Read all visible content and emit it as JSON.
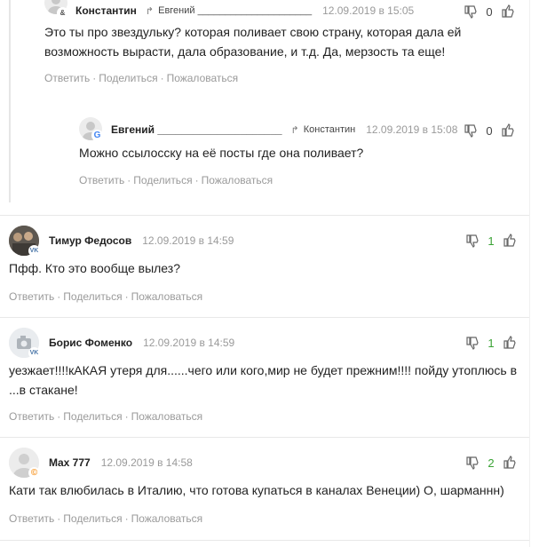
{
  "actions": {
    "reply": "Ответить",
    "share": "Поделиться",
    "report": "Пожаловаться",
    "separator": "·"
  },
  "comments": [
    {
      "author": "Константин",
      "reply_to": "Евгений _____________________",
      "date": "12.09.2019 в 15:05",
      "text": "Это ты про звездульку? которая поливает свою страну, которая дала ей возможность вырасти, дала образование, и т.д. Да, мерзость та еще!",
      "votes": "0",
      "avatar_badge": "&"
    },
    {
      "author": "Евгений _____________________",
      "reply_to": "Константин",
      "date": "12.09.2019 в 15:08",
      "text": "Можно ссылосску на её посты где она поливает?",
      "votes": "0",
      "avatar_badge": "G"
    },
    {
      "author": "Тимур Федосов",
      "date": "12.09.2019 в 14:59",
      "text": "Пфф. Кто это вообще вылез?",
      "votes": "1",
      "avatar_badge": "VK"
    },
    {
      "author": "Борис Фоменко",
      "date": "12.09.2019 в 14:59",
      "text": "уезжает!!!!кАКАЯ утеря для......чего или кого,мир не будет прежним!!!! пойду утоплюсь в ...в стакане!",
      "votes": "1",
      "avatar_badge": "VK"
    },
    {
      "author": "Max 777",
      "date": "12.09.2019 в 14:58",
      "text": "Кати так влюбилась в Италию, что готова купаться в каналах Венеции) О, шарманнн)",
      "votes": "2",
      "avatar_badge": "©"
    }
  ],
  "colors": {
    "positive": "#3aa335",
    "muted": "#9a9a9a",
    "google_blue": "#4285f4",
    "vk_blue": "#4a76a8",
    "ok_orange": "#f7931e"
  },
  "icons": {
    "dislike": "thumbs-down-icon",
    "like": "thumbs-up-icon",
    "reply_arrow": "reply-arrow-icon"
  }
}
